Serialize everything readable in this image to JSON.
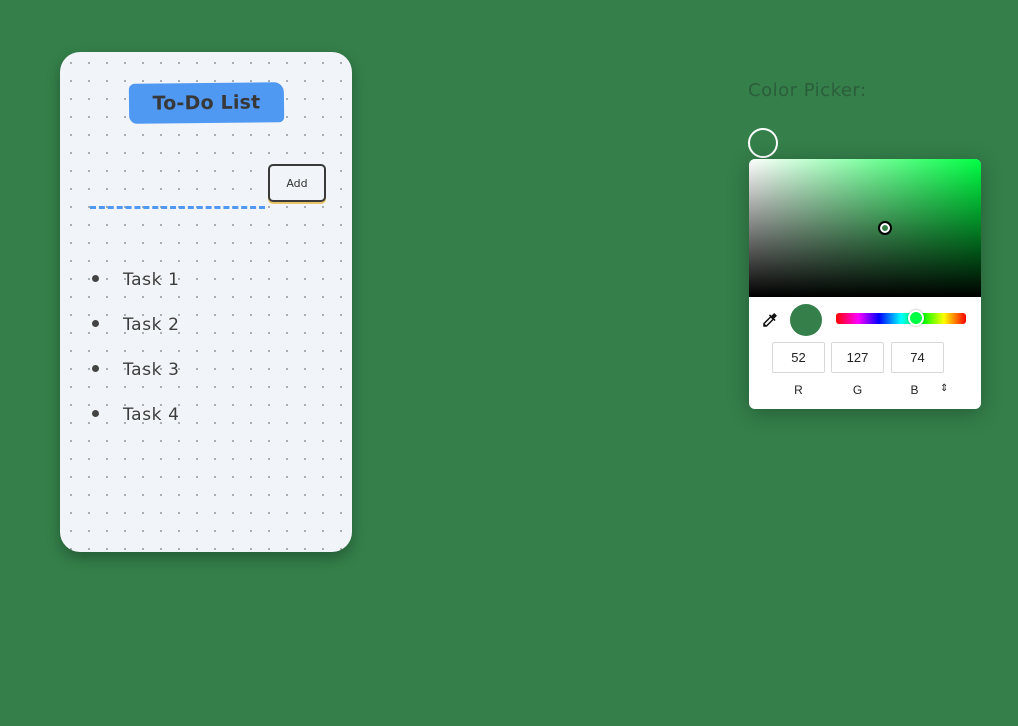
{
  "todo": {
    "title": "To-Do List",
    "input_value": "",
    "add_label": "Add",
    "tasks": [
      {
        "label": "Task 1"
      },
      {
        "label": "Task 2"
      },
      {
        "label": "Task 3"
      },
      {
        "label": "Task 4"
      }
    ]
  },
  "color_picker": {
    "label": "Color Picker:",
    "selected_color": "#347f4a",
    "hue_color": "#00ff44",
    "rgb": {
      "r": "52",
      "g": "127",
      "b": "74"
    },
    "channel_labels": {
      "r": "R",
      "g": "G",
      "b": "B"
    },
    "mode_toggle_icon": "⇕",
    "eyedropper_icon": "eyedropper-icon"
  },
  "colors": {
    "background": "#347f4a",
    "card": "#f1f4f8",
    "title_highlight": "#5099f2",
    "input_underline": "#5099f2"
  }
}
